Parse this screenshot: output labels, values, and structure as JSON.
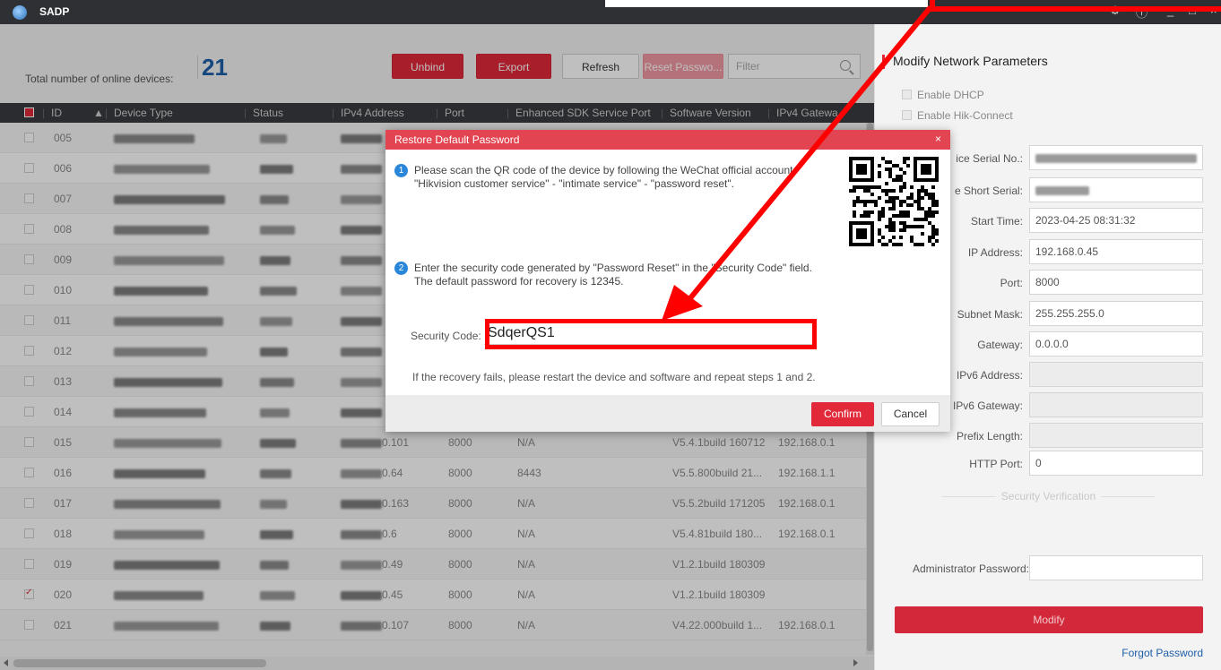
{
  "app": {
    "title": "SADP"
  },
  "toolbar": {
    "total_label": "Total number of online devices:",
    "total_count": "21",
    "unbind": "Unbind",
    "export": "Export",
    "refresh": "Refresh",
    "reset_password": "Reset Passwo...",
    "filter_placeholder": "Filter"
  },
  "table": {
    "headers": [
      "ID",
      "Device Type",
      "Status",
      "IPv4 Address",
      "Port",
      "Enhanced SDK Service Port",
      "Software Version",
      "IPv4 Gatewa"
    ],
    "rows": [
      {
        "id": "005",
        "ip_suffix": "",
        "port": "",
        "sdk": "",
        "version": "",
        "gateway": "",
        "checked": false
      },
      {
        "id": "006",
        "ip_suffix": "",
        "port": "",
        "sdk": "",
        "version": "",
        "gateway": "",
        "checked": false
      },
      {
        "id": "007",
        "ip_suffix": "",
        "port": "",
        "sdk": "",
        "version": "",
        "gateway": "",
        "checked": false
      },
      {
        "id": "008",
        "ip_suffix": "",
        "port": "",
        "sdk": "",
        "version": "",
        "gateway": "",
        "checked": false
      },
      {
        "id": "009",
        "ip_suffix": "",
        "port": "",
        "sdk": "",
        "version": "",
        "gateway": "",
        "checked": false
      },
      {
        "id": "010",
        "ip_suffix": "",
        "port": "",
        "sdk": "",
        "version": "",
        "gateway": "",
        "checked": false
      },
      {
        "id": "011",
        "ip_suffix": "",
        "port": "",
        "sdk": "",
        "version": "",
        "gateway": "",
        "checked": false
      },
      {
        "id": "012",
        "ip_suffix": "",
        "port": "",
        "sdk": "",
        "version": "",
        "gateway": "",
        "checked": false
      },
      {
        "id": "013",
        "ip_suffix": "",
        "port": "",
        "sdk": "",
        "version": "",
        "gateway": "",
        "checked": false
      },
      {
        "id": "014",
        "ip_suffix": "",
        "port": "",
        "sdk": "",
        "version": "",
        "gateway": "",
        "checked": false
      },
      {
        "id": "015",
        "ip_suffix": "0.101",
        "port": "8000",
        "sdk": "N/A",
        "version": "V5.4.1build 160712",
        "gateway": "192.168.0.1",
        "checked": false
      },
      {
        "id": "016",
        "ip_suffix": "0.64",
        "port": "8000",
        "sdk": "8443",
        "version": "V5.5.800build 21...",
        "gateway": "192.168.1.1",
        "checked": false
      },
      {
        "id": "017",
        "ip_suffix": "0.163",
        "port": "8000",
        "sdk": "N/A",
        "version": "V5.5.2build 171205",
        "gateway": "192.168.0.1",
        "checked": false
      },
      {
        "id": "018",
        "ip_suffix": "0.6",
        "port": "8000",
        "sdk": "N/A",
        "version": "V5.4.81build 180...",
        "gateway": "192.168.0.1",
        "checked": false
      },
      {
        "id": "019",
        "ip_suffix": "0.49",
        "port": "8000",
        "sdk": "N/A",
        "version": "V1.2.1build 180309",
        "gateway": "",
        "checked": false
      },
      {
        "id": "020",
        "ip_suffix": "0.45",
        "port": "8000",
        "sdk": "N/A",
        "version": "V1.2.1build 180309",
        "gateway": "",
        "checked": true
      },
      {
        "id": "021",
        "ip_suffix": "0.107",
        "port": "8000",
        "sdk": "N/A",
        "version": "V4.22.000build 1...",
        "gateway": "192.168.0.1",
        "checked": false
      }
    ]
  },
  "right_panel": {
    "title": "Modify Network Parameters",
    "enable_dhcp": "Enable DHCP",
    "enable_hik": "Enable Hik-Connect",
    "fields": [
      {
        "label": "ice Serial No.:",
        "value": ""
      },
      {
        "label": "e Short Serial:",
        "value": ""
      },
      {
        "label": "Start Time:",
        "value": "2023-04-25 08:31:32"
      },
      {
        "label": "IP Address:",
        "value": "192.168.0.45"
      },
      {
        "label": "Port:",
        "value": "8000"
      },
      {
        "label": "Subnet Mask:",
        "value": "255.255.255.0"
      },
      {
        "label": "Gateway:",
        "value": "0.0.0.0"
      },
      {
        "label": "IPv6 Address:",
        "value": ""
      },
      {
        "label": "IPv6 Gateway:",
        "value": ""
      },
      {
        "label": "Prefix Length:",
        "value": ""
      },
      {
        "label": "HTTP Port:",
        "value": "0"
      }
    ],
    "security_verification": "Security Verification",
    "admin_password_label": "Administrator Password:",
    "modify": "Modify",
    "forgot_password": "Forgot Password"
  },
  "dialog": {
    "title": "Restore Default Password",
    "close": "×",
    "step1_num": "1",
    "step1_line1": "Please scan the QR code of the device by following the WeChat official account",
    "step1_line2": "\"Hikvision customer service\" - \"intimate service\" - \"password reset\".",
    "step2_num": "2",
    "step2_line1": "Enter the security code generated by \"Password Reset\" in the \"Security Code\" field.",
    "step2_line2": "The default password for recovery is 12345.",
    "security_code_label": "Security Code:",
    "security_code_value": "SdqerQS1",
    "recovery_note": "If the recovery fails, please restart the device and software and repeat steps 1 and 2.",
    "confirm": "Confirm",
    "cancel": "Cancel"
  },
  "colors": {
    "accent": "#e1293a",
    "annotation": "#ff0000",
    "link": "#1e5fa8"
  }
}
